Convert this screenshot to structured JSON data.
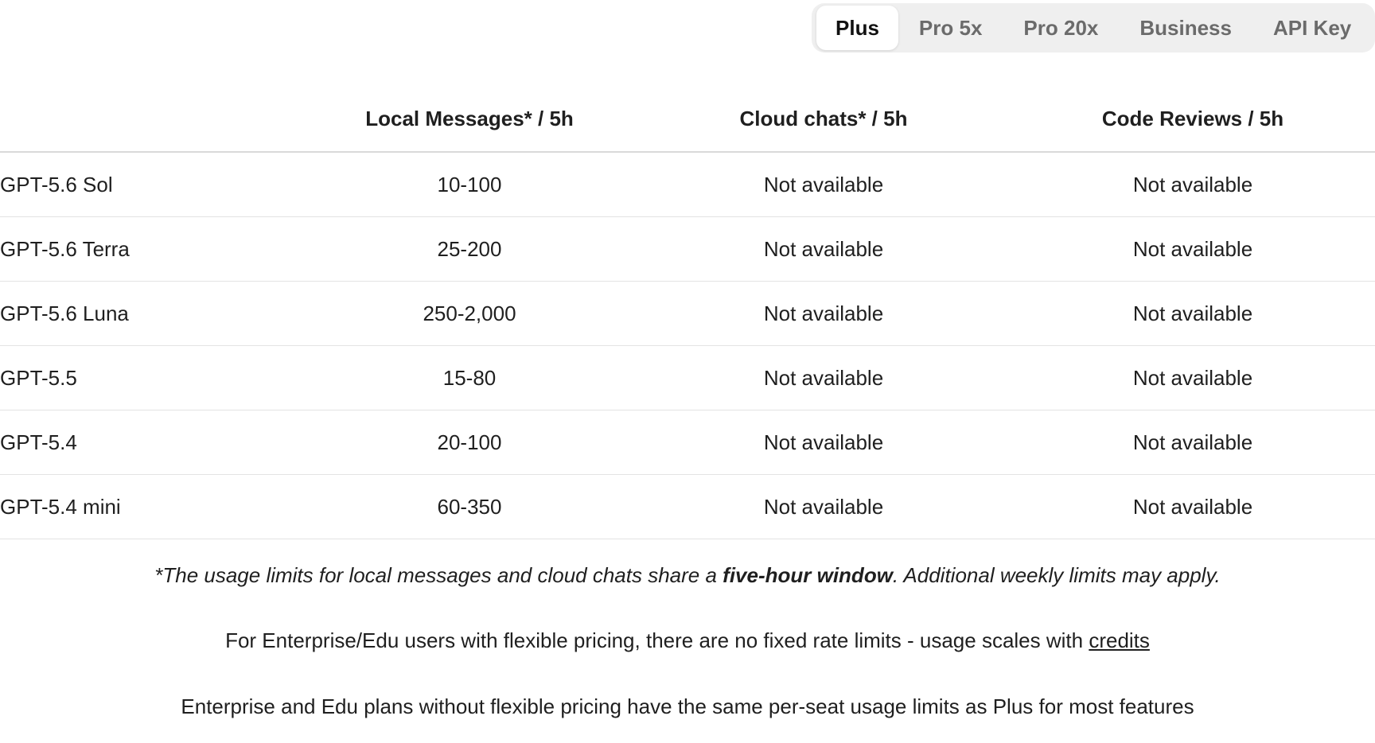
{
  "plan_tabs": [
    {
      "label": "Plus",
      "active": true
    },
    {
      "label": "Pro 5x",
      "active": false
    },
    {
      "label": "Pro 20x",
      "active": false
    },
    {
      "label": "Business",
      "active": false
    },
    {
      "label": "API Key",
      "active": false
    }
  ],
  "table": {
    "headers": [
      "",
      "Local Messages* / 5h",
      "Cloud chats* / 5h",
      "Code Reviews / 5h"
    ],
    "rows": [
      {
        "model": "GPT-5.6 Sol",
        "local": "10-100",
        "cloud": "Not available",
        "review": "Not available"
      },
      {
        "model": "GPT-5.6 Terra",
        "local": "25-200",
        "cloud": "Not available",
        "review": "Not available"
      },
      {
        "model": "GPT-5.6 Luna",
        "local": "250-2,000",
        "cloud": "Not available",
        "review": "Not available"
      },
      {
        "model": "GPT-5.5",
        "local": "15-80",
        "cloud": "Not available",
        "review": "Not available"
      },
      {
        "model": "GPT-5.4",
        "local": "20-100",
        "cloud": "Not available",
        "review": "Not available"
      },
      {
        "model": "GPT-5.4 mini",
        "local": "60-350",
        "cloud": "Not available",
        "review": "Not available"
      }
    ]
  },
  "notes": {
    "usage_prefix": "*The usage limits for local messages and cloud chats share a ",
    "usage_bold": "five-hour window",
    "usage_suffix": ". Additional weekly limits may apply.",
    "flex_text": "For Enterprise/Edu users with flexible pricing, there are no fixed rate limits - usage scales with ",
    "flex_link": "credits",
    "enterprise_text": "Enterprise and Edu plans without flexible pricing have the same per-seat usage limits as Plus for most features"
  }
}
